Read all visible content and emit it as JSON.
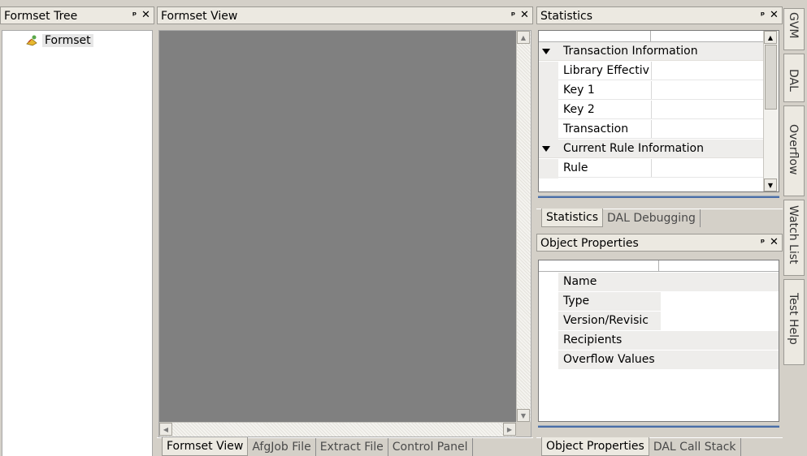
{
  "formset_tree": {
    "title": "Formset Tree",
    "pin_glyph": "ᵖ",
    "close_glyph": "✕",
    "nodes": [
      {
        "label": "Formset",
        "icon": "formset-icon"
      }
    ]
  },
  "formset_view": {
    "title": "Formset View",
    "tabs": [
      {
        "label": "Formset View",
        "active": true
      },
      {
        "label": "AfgJob File",
        "active": false
      },
      {
        "label": "Extract File",
        "active": false
      },
      {
        "label": "Control Panel",
        "active": false
      }
    ]
  },
  "statistics": {
    "title": "Statistics",
    "rows": [
      {
        "type": "category",
        "label": "Transaction Information"
      },
      {
        "type": "item",
        "label": "Library Effectiv"
      },
      {
        "type": "item",
        "label": "Key 1"
      },
      {
        "type": "item",
        "label": "Key 2"
      },
      {
        "type": "item",
        "label": "Transaction"
      },
      {
        "type": "category",
        "label": "Current Rule Information"
      },
      {
        "type": "item",
        "label": "Rule"
      }
    ],
    "tabs": [
      {
        "label": "Statistics",
        "active": true
      },
      {
        "label": "DAL Debugging",
        "active": false
      }
    ]
  },
  "object_properties": {
    "title": "Object Properties",
    "rows": [
      {
        "label": "Name",
        "shaded": true
      },
      {
        "label": "Type",
        "shaded": false
      },
      {
        "label": "Version/Revisic",
        "shaded": false
      },
      {
        "label": "Recipients",
        "shaded": true
      },
      {
        "label": "Overflow Values",
        "shaded": true
      }
    ],
    "tabs": [
      {
        "label": "Object Properties",
        "active": true
      },
      {
        "label": "DAL Call Stack",
        "active": false
      }
    ]
  },
  "side_tabs": [
    "GVM",
    "DAL",
    "Overflow",
    "Watch List",
    "Test Help"
  ],
  "colors": {
    "view_canvas": "#808080",
    "panel_bg": "#d4d0c8",
    "category_row": "#eeedeb",
    "accent_line": "#4a6ea8"
  }
}
